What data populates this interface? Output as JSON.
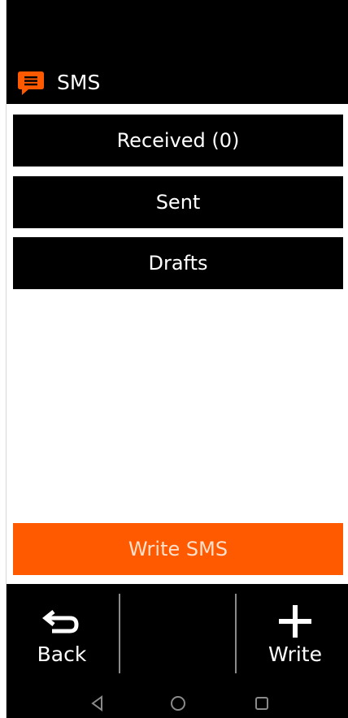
{
  "header": {
    "title": "SMS",
    "icon": "chat-bubble-icon",
    "accent_color": "#ff5a00"
  },
  "menu": {
    "items": [
      {
        "label": "Received (0)"
      },
      {
        "label": "Sent"
      },
      {
        "label": "Drafts"
      }
    ]
  },
  "write_sms_button": {
    "label": "Write SMS",
    "color": "#ff5a00"
  },
  "bottom_bar": {
    "back_label": "Back",
    "back_icon": "return-arrow-icon",
    "write_label": "Write",
    "write_icon": "plus-icon"
  },
  "system_nav": {
    "back_icon": "triangle-back-icon",
    "home_icon": "circle-home-icon",
    "recents_icon": "square-recents-icon"
  }
}
